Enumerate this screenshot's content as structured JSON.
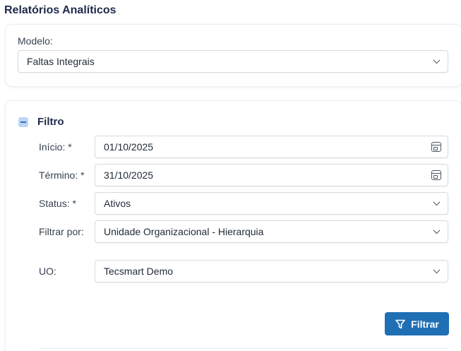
{
  "page": {
    "title": "Relatórios Analíticos"
  },
  "model": {
    "label": "Modelo:",
    "value": "Faltas Integrais"
  },
  "filter": {
    "title": "Filtro",
    "start": {
      "label": "Início: *",
      "value": "01/10/2025"
    },
    "end": {
      "label": "Término: *",
      "value": "31/10/2025"
    },
    "status": {
      "label": "Status: *",
      "value": "Ativos"
    },
    "filter_by": {
      "label": "Filtrar por:",
      "value": "Unidade Organizacional - Hierarquia"
    },
    "uo": {
      "label": "UO:",
      "value": "Tecsmart Demo"
    },
    "button_label": "Filtrar"
  },
  "icons": {
    "start_picker": "calendar-icon",
    "end_picker": "calendar-icon",
    "toggle": "minus-square-icon",
    "button": "funnel-icon",
    "dropdown": "chevron-down-icon"
  },
  "colors": {
    "accent": "#1f6fb5",
    "title": "#1e2a4a",
    "toggle_bg": "#bdd5f3"
  }
}
